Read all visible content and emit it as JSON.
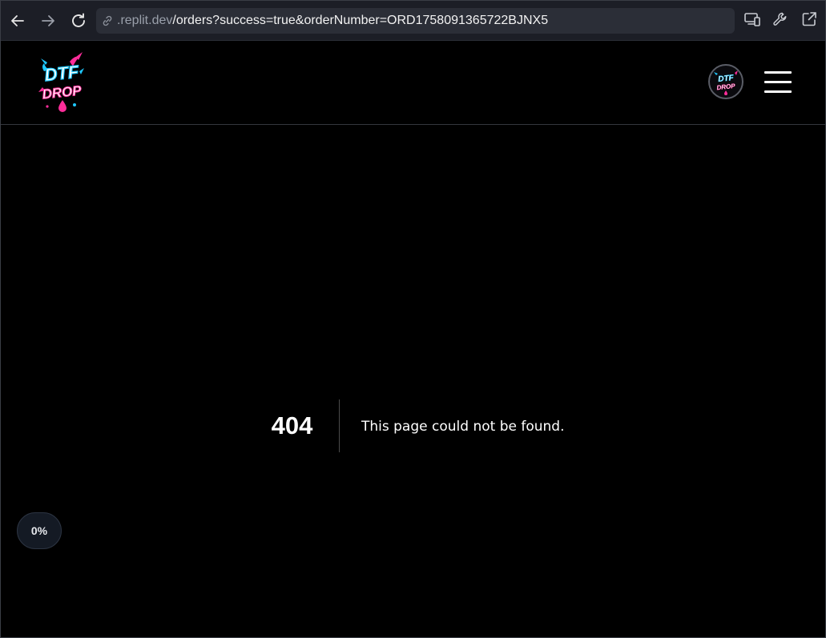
{
  "browser": {
    "url_host": ".replit.dev",
    "url_path": "/orders?success=true&orderNumber=ORD1758091365722BJNX5",
    "icons": [
      "back-arrow-icon",
      "forward-arrow-icon",
      "reload-icon",
      "link-icon",
      "devices-icon",
      "wrench-icon",
      "open-external-icon"
    ]
  },
  "header": {
    "logo_text_line1": "DTF",
    "logo_text_line2": "DROP",
    "avatar_text_line1": "DTF",
    "avatar_text_line2": "DROP",
    "menu_icon": "hamburger-menu-icon"
  },
  "error": {
    "code": "404",
    "message": "This page could not be found."
  },
  "progress": {
    "label": "0%",
    "value": 0
  },
  "colors": {
    "background": "#000000",
    "toolbar": "#1c1e26",
    "urlbar": "#2b2e37",
    "logo_pink": "#ff2d9a",
    "logo_cyan": "#1fc8ff"
  }
}
